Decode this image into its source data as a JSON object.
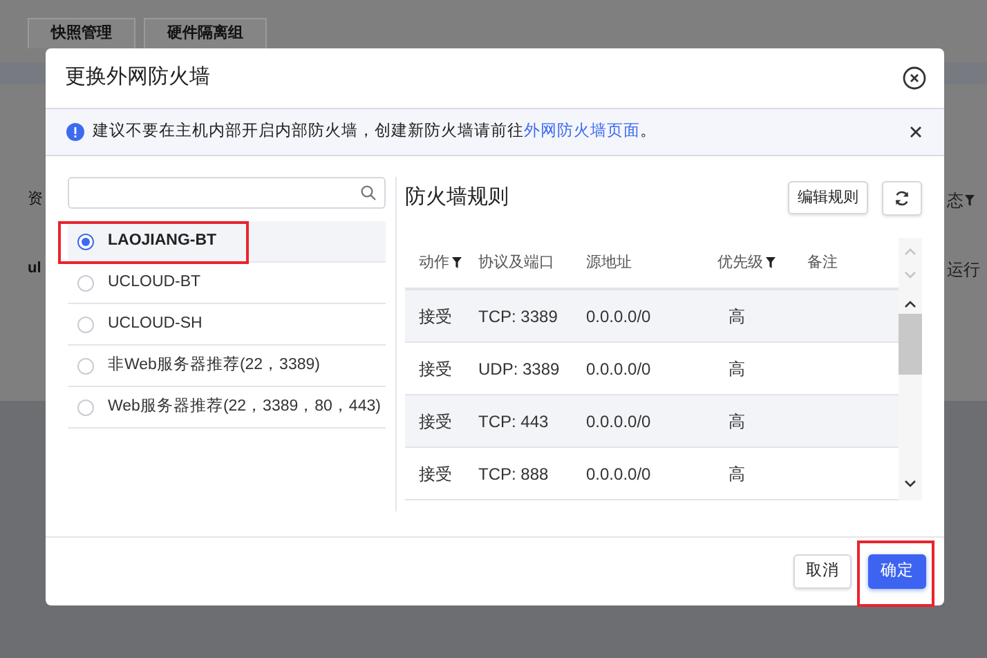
{
  "background_page": {
    "tabs": [
      "快照管理",
      "硬件隔离组"
    ],
    "left_fragments": [
      "资",
      "ul"
    ],
    "right_fragments": [
      {
        "text": "态",
        "filter": true
      },
      {
        "text": "运行",
        "filter": false
      }
    ]
  },
  "dialog": {
    "title": "更换外网防火墙",
    "alert": {
      "text": "建议不要在主机内部开启内部防火墙，创建新防火墙请前往",
      "link": "外网防火墙页面",
      "tail": "。"
    },
    "firewalls": [
      {
        "label": "LAOJIANG-BT",
        "selected": true,
        "highlighted": true
      },
      {
        "label": "UCLOUD-BT",
        "selected": false,
        "highlighted": false
      },
      {
        "label": "UCLOUD-SH",
        "selected": false,
        "highlighted": false
      },
      {
        "label": "非Web服务器推荐(22，3389)",
        "selected": false,
        "highlighted": false
      },
      {
        "label": "Web服务器推荐(22，3389，80，443)",
        "selected": false,
        "highlighted": false
      }
    ],
    "rules_title": "防火墙规则",
    "edit_button": "编辑规则",
    "columns": [
      {
        "label": "动作",
        "filter": true
      },
      {
        "label": "协议及端口",
        "filter": false
      },
      {
        "label": "源地址",
        "filter": false
      },
      {
        "label": "优先级",
        "filter": true
      },
      {
        "label": "备注",
        "filter": false
      }
    ],
    "rows": [
      {
        "action": "接受",
        "protocol": "TCP: 3389",
        "source": "0.0.0.0/0",
        "priority": "高"
      },
      {
        "action": "接受",
        "protocol": "UDP: 3389",
        "source": "0.0.0.0/0",
        "priority": "高"
      },
      {
        "action": "接受",
        "protocol": "TCP: 443",
        "source": "0.0.0.0/0",
        "priority": "高"
      },
      {
        "action": "接受",
        "protocol": "TCP: 888",
        "source": "0.0.0.0/0",
        "priority": "高"
      }
    ],
    "buttons": [
      {
        "label": "取消",
        "kind": "secondary",
        "highlighted": false
      },
      {
        "label": "确定",
        "kind": "primary",
        "highlighted": true
      }
    ]
  }
}
